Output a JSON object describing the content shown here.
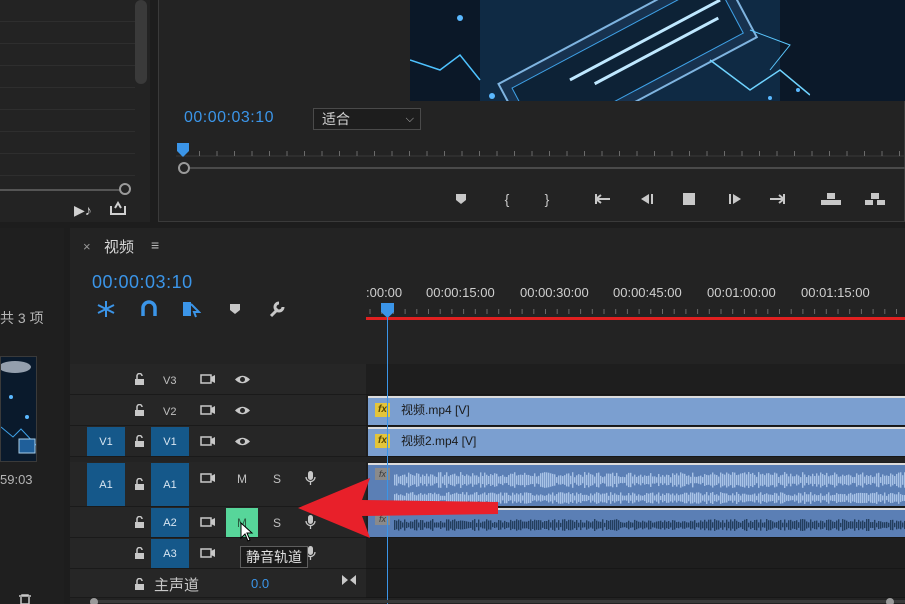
{
  "monitor": {
    "timecode": "00:00:03:10",
    "fit": "适合",
    "controls": [
      "marker-icon",
      "mark-in-icon",
      "mark-out-icon",
      "go-to-in-icon",
      "step-back-icon",
      "stop-icon",
      "step-forward-icon",
      "go-to-out-icon",
      "lift-icon",
      "extract-icon"
    ]
  },
  "project": {
    "item_count": "共 3 项",
    "thumb_duration": "59:03"
  },
  "timeline": {
    "close": "×",
    "tab": "视频",
    "menu": "≡",
    "timecode": "00:00:03:10",
    "ruler": ":00:00",
    "ruler_labels": [
      "00:00:15:00",
      "00:00:30:00",
      "00:00:45:00",
      "00:01:00:00",
      "00:01:15:00"
    ],
    "tracks": {
      "v3": "V3",
      "v2": "V2",
      "v1_patch": "V1",
      "v1": "V1",
      "a1_patch": "A1",
      "a1": "A1",
      "a2": "A2",
      "a3": "A3",
      "mute": "M",
      "solo": "S"
    },
    "clips": {
      "v2": "视频.mp4 [V]",
      "v1": "视频2.mp4 [V]",
      "fx": "fx"
    },
    "master_label": "主声道",
    "master_value": "0.0",
    "tooltip": "静音轨道"
  },
  "colors": {
    "accent_blue": "#3b95e8",
    "track_patch": "#15588a",
    "mute_active": "#57d69a",
    "video_clip": "#7b9fd0",
    "audio_clip": "#5b7fb5",
    "work_area": "#e02020",
    "annotation_arrow": "#e8202a"
  }
}
